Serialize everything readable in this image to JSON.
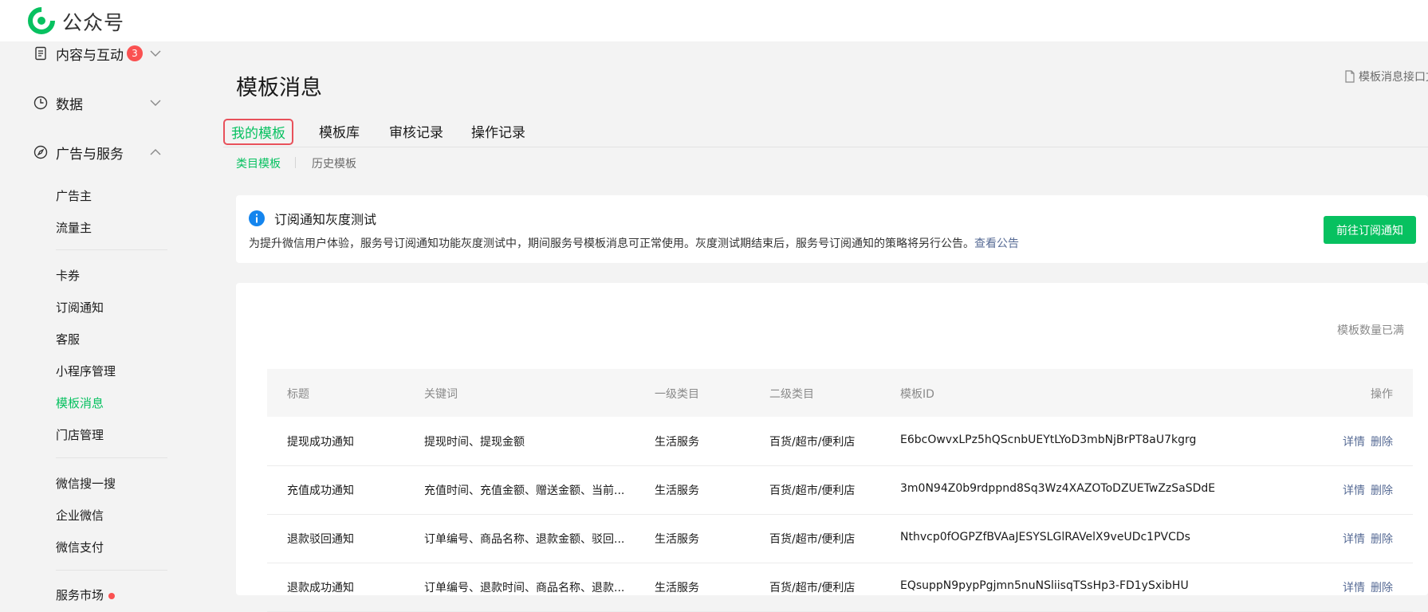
{
  "brand": {
    "name": "公众号",
    "color": "#07c160"
  },
  "sidebar": {
    "group_content": {
      "label": "内容与互动",
      "badge": "3",
      "icon": "document-icon"
    },
    "group_data": {
      "label": "数据",
      "icon": "clock-icon"
    },
    "group_ads": {
      "label": "广告与服务",
      "icon": "compass-icon"
    },
    "items": [
      {
        "label": "广告主"
      },
      {
        "label": "流量主"
      },
      {
        "label": "卡券"
      },
      {
        "label": "订阅通知"
      },
      {
        "label": "客服"
      },
      {
        "label": "小程序管理"
      },
      {
        "label": "模板消息",
        "active": true
      },
      {
        "label": "门店管理"
      },
      {
        "label": "微信搜一搜"
      },
      {
        "label": "企业微信"
      },
      {
        "label": "微信支付"
      },
      {
        "label": "服务市场"
      }
    ]
  },
  "main": {
    "title": "模板消息",
    "doc_link": "模板消息接口文",
    "tabs": [
      {
        "label": "我的模板",
        "active": true
      },
      {
        "label": "模板库"
      },
      {
        "label": "审核记录"
      },
      {
        "label": "操作记录"
      }
    ],
    "subtabs": [
      {
        "label": "类目模板",
        "active": true
      },
      {
        "label": "历史模板"
      }
    ],
    "notice": {
      "title": "订阅通知灰度测试",
      "text": "为提升微信用户体验，服务号订阅通知功能灰度测试中，期间服务号模板消息可正常使用。灰度测试期结束后，服务号订阅通知的策略将另行公告。",
      "link": "查看公告",
      "button": "前往订阅通知"
    },
    "count_note": "模板数量已满",
    "table": {
      "headers": [
        "标题",
        "关键词",
        "一级类目",
        "二级类目",
        "模板ID",
        "操作"
      ],
      "rows": [
        {
          "title": "提现成功通知",
          "keywords": "提现时间、提现金额",
          "cat1": "生活服务",
          "cat2": "百货/超市/便利店",
          "id": "E6bcOwvxLPz5hQScnbUEYtLYoD3mbNjBrPT8aU7kgrg",
          "detail": "详情",
          "delete": "删除"
        },
        {
          "title": "充值成功通知",
          "keywords": "充值时间、充值金额、赠送金额、当前...",
          "cat1": "生活服务",
          "cat2": "百货/超市/便利店",
          "id": "3m0N94Z0b9rdppnd8Sq3Wz4XAZOToDZUETwZzSaSDdE",
          "detail": "详情",
          "delete": "删除"
        },
        {
          "title": "退款驳回通知",
          "keywords": "订单编号、商品名称、退款金额、驳回...",
          "cat1": "生活服务",
          "cat2": "百货/超市/便利店",
          "id": "Nthvcp0fOGPZfBVAaJESYSLGlRAVelX9veUDc1PVCDs",
          "detail": "详情",
          "delete": "删除"
        },
        {
          "title": "退款成功通知",
          "keywords": "订单编号、退款时间、商品名称、退款...",
          "cat1": "生活服务",
          "cat2": "百货/超市/便利店",
          "id": "EQsuppN9pypPgjmn5nuNSliisqTSsHp3-FD1ySxibHU",
          "detail": "详情",
          "delete": "删除"
        }
      ]
    }
  }
}
